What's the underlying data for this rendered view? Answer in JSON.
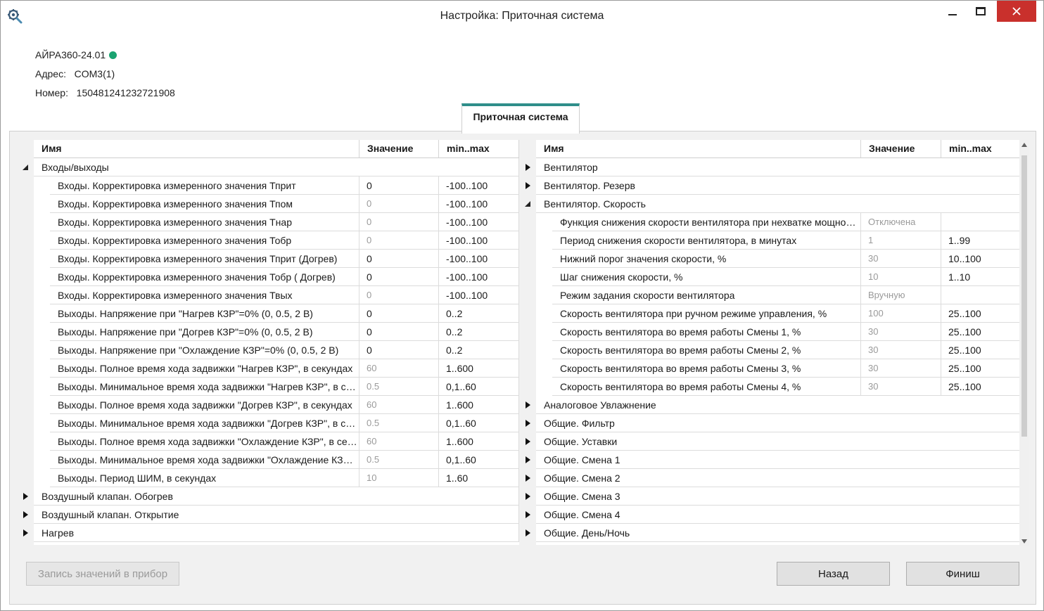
{
  "window": {
    "title": "Настройка: Приточная система"
  },
  "device": {
    "name": "АЙРА360-24.01",
    "address_label": "Адрес:",
    "address": "COM3(1)",
    "number_label": "Номер:",
    "number": "150481241232721908",
    "status_color": "#1aa370"
  },
  "tab": {
    "label": "Приточная система",
    "accent": "#2f8e8a"
  },
  "columns": {
    "name": "Имя",
    "value": "Значение",
    "range": "min..max"
  },
  "left_grid": {
    "rows": [
      {
        "type": "group",
        "expanded": true,
        "name": "Входы/выходы"
      },
      {
        "type": "item",
        "name": "Входы. Корректировка измеренного значения  Тприт",
        "value": "0",
        "editable": true,
        "range": "-100..100"
      },
      {
        "type": "item",
        "name": "Входы. Корректировка измеренного значения  Тпом",
        "value": "0",
        "editable": false,
        "range": "-100..100"
      },
      {
        "type": "item",
        "name": "Входы. Корректировка измеренного значения  Тнар",
        "value": "0",
        "editable": false,
        "range": "-100..100"
      },
      {
        "type": "item",
        "name": "Входы. Корректировка измеренного значения  Тобр",
        "value": "0",
        "editable": false,
        "range": "-100..100"
      },
      {
        "type": "item",
        "name": "Входы. Корректировка измеренного значения  Тприт (Догрев)",
        "value": "0",
        "editable": true,
        "range": "-100..100"
      },
      {
        "type": "item",
        "name": "Входы. Корректировка измеренного значения  Тобр ( Догрев)",
        "value": "0",
        "editable": true,
        "range": "-100..100"
      },
      {
        "type": "item",
        "name": "Входы. Корректировка измеренного значения  Твых",
        "value": "0",
        "editable": false,
        "range": "-100..100"
      },
      {
        "type": "item",
        "name": "Выходы. Напряжение при \"Нагрев КЗР\"=0%  (0, 0.5, 2 В)",
        "value": "0",
        "editable": true,
        "range": "0..2"
      },
      {
        "type": "item",
        "name": "Выходы. Напряжение при \"Догрев КЗР\"=0%  (0, 0.5, 2 В)",
        "value": "0",
        "editable": true,
        "range": "0..2"
      },
      {
        "type": "item",
        "name": "Выходы. Напряжение при \"Охлаждение КЗР\"=0%  (0, 0.5, 2 В)",
        "value": "0",
        "editable": true,
        "range": "0..2"
      },
      {
        "type": "item",
        "name": "Выходы. Полное время хода задвижки \"Нагрев КЗР\", в секундах",
        "value": "60",
        "editable": false,
        "range": "1..600"
      },
      {
        "type": "item",
        "name": "Выходы. Минимальное время хода задвижки \"Нагрев КЗР\", в секундах",
        "value": "0.5",
        "editable": false,
        "range": "0,1..60"
      },
      {
        "type": "item",
        "name": "Выходы. Полное время хода задвижки \"Догрев КЗР\", в секундах",
        "value": "60",
        "editable": false,
        "range": "1..600"
      },
      {
        "type": "item",
        "name": "Выходы. Минимальное время хода задвижки \"Догрев КЗР\", в секундах",
        "value": "0.5",
        "editable": false,
        "range": "0,1..60"
      },
      {
        "type": "item",
        "name": "Выходы. Полное время хода задвижки \"Охлаждение КЗР\", в секундах",
        "value": "60",
        "editable": false,
        "range": "1..600"
      },
      {
        "type": "item",
        "name": "Выходы. Минимальное время хода задвижки \"Охлаждение КЗР\", в секундах",
        "value": "0.5",
        "editable": false,
        "range": "0,1..60"
      },
      {
        "type": "item",
        "name": "Выходы. Период ШИМ, в секундах",
        "value": "10",
        "editable": false,
        "range": "1..60"
      },
      {
        "type": "group",
        "expanded": false,
        "name": "Воздушный клапан. Обогрев"
      },
      {
        "type": "group",
        "expanded": false,
        "name": "Воздушный клапан. Открытие"
      },
      {
        "type": "group",
        "expanded": false,
        "name": "Нагрев"
      }
    ]
  },
  "right_grid": {
    "rows": [
      {
        "type": "group",
        "expanded": false,
        "name": "Вентилятор"
      },
      {
        "type": "group",
        "expanded": false,
        "name": "Вентилятор. Резерв"
      },
      {
        "type": "group",
        "expanded": true,
        "name": "Вентилятор. Скорость"
      },
      {
        "type": "item",
        "name": "Функция снижения скорости вентилятора при нехватке мощности",
        "value": "Отключена",
        "editable": false,
        "range": ""
      },
      {
        "type": "item",
        "name": "Период снижения скорости вентилятора, в минутах",
        "value": "1",
        "editable": false,
        "range": "1..99"
      },
      {
        "type": "item",
        "name": "Нижний порог значения скорости, %",
        "value": "30",
        "editable": false,
        "range": "10..100"
      },
      {
        "type": "item",
        "name": "Шаг снижения скорости, %",
        "value": "10",
        "editable": false,
        "range": "1..10"
      },
      {
        "type": "item",
        "name": "Режим задания скорости вентилятора",
        "value": "Вручную",
        "editable": false,
        "range": ""
      },
      {
        "type": "item",
        "name": "Скорость вентилятора при ручном режиме управления, %",
        "value": "100",
        "editable": false,
        "range": "25..100"
      },
      {
        "type": "item",
        "name": "Скорость вентилятора во время работы Смены 1, %",
        "value": "30",
        "editable": false,
        "range": "25..100"
      },
      {
        "type": "item",
        "name": "Скорость вентилятора во время работы Смены 2, %",
        "value": "30",
        "editable": false,
        "range": "25..100"
      },
      {
        "type": "item",
        "name": "Скорость вентилятора во время работы Смены 3, %",
        "value": "30",
        "editable": false,
        "range": "25..100"
      },
      {
        "type": "item",
        "name": "Скорость вентилятора во время работы Смены 4, %",
        "value": "30",
        "editable": false,
        "range": "25..100"
      },
      {
        "type": "group",
        "expanded": false,
        "name": "Аналоговое Увлажнение"
      },
      {
        "type": "group",
        "expanded": false,
        "name": "Общие. Фильтр"
      },
      {
        "type": "group",
        "expanded": false,
        "name": "Общие. Уставки"
      },
      {
        "type": "group",
        "expanded": false,
        "name": "Общие. Смена 1"
      },
      {
        "type": "group",
        "expanded": false,
        "name": "Общие. Смена 2"
      },
      {
        "type": "group",
        "expanded": false,
        "name": "Общие. Смена 3"
      },
      {
        "type": "group",
        "expanded": false,
        "name": "Общие. Смена 4"
      },
      {
        "type": "group",
        "expanded": false,
        "name": "Общие. День/Ночь"
      }
    ]
  },
  "buttons": {
    "write": "Запись значений в прибор",
    "back": "Назад",
    "finish": "Финиш"
  }
}
